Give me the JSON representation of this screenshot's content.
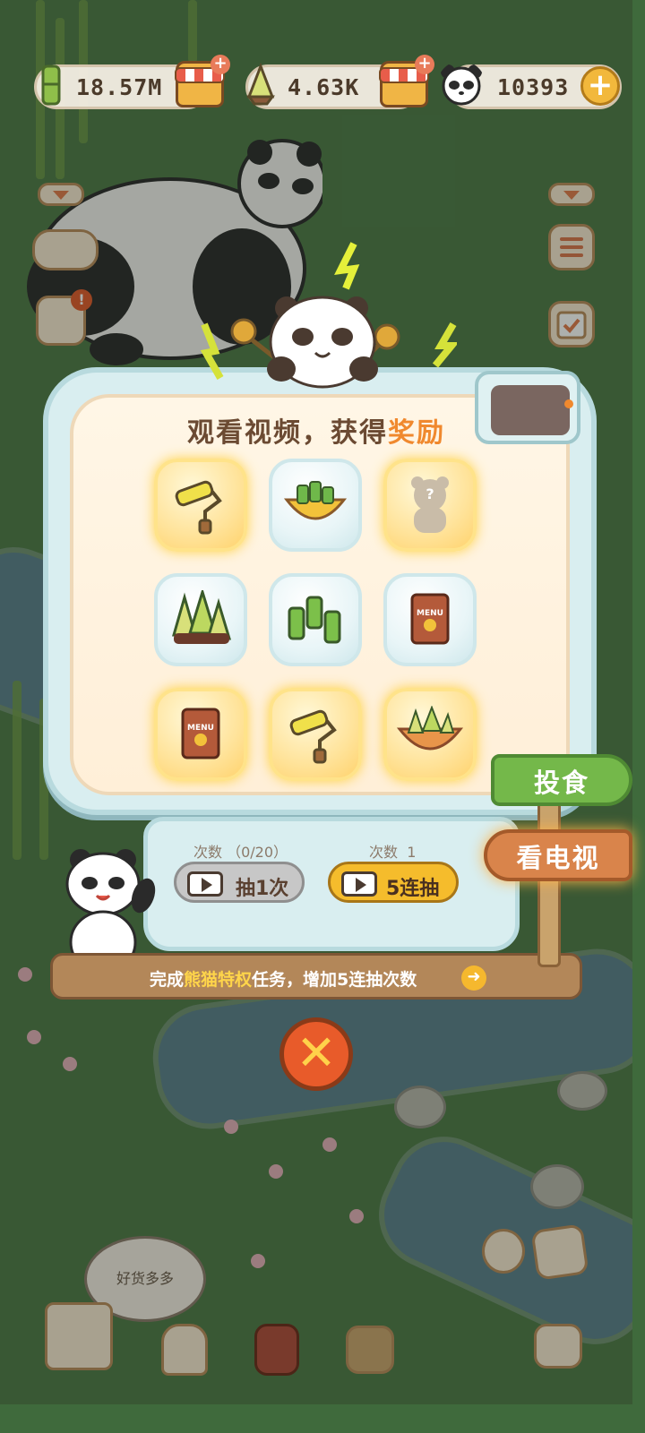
{
  "resources": {
    "bamboo_amount": "18.57M",
    "shoots_amount": "4.63K",
    "panda_coins": "10393"
  },
  "dialog": {
    "title_prefix": "观看视频，获得",
    "title_highlight": "奖励",
    "rewards": [
      {
        "item": "paint-roller",
        "style": "gold"
      },
      {
        "item": "bamboo-bowl",
        "style": "blue"
      },
      {
        "item": "mystery-bear",
        "style": "gold"
      },
      {
        "item": "bamboo-shoots",
        "style": "blue"
      },
      {
        "item": "bamboo-stalks",
        "style": "blue"
      },
      {
        "item": "menu-book",
        "style": "blue"
      },
      {
        "item": "menu-book",
        "style": "gold"
      },
      {
        "item": "paint-roller",
        "style": "gold"
      },
      {
        "item": "bamboo-shoot-bowl",
        "style": "gold"
      }
    ],
    "mystery_mark": "?",
    "menu_label": "MENU",
    "single_count_label": "次数",
    "single_count_value": "（0/20）",
    "five_count_label": "次数",
    "five_count_value": "1",
    "single_draw_label": "抽1次",
    "five_draw_label": "5连抽",
    "banner_prefix": "完成",
    "banner_highlight": "熊猫特权",
    "banner_suffix": "任务，增加5连抽次数",
    "banner_arrow": "➜",
    "close_symbol": "✕"
  },
  "signs": {
    "feed": "投食",
    "watch_tv": "看电视"
  },
  "world": {
    "speech_bubble": "好货多多",
    "add_symbol": "+"
  },
  "colors": {
    "accent_orange": "#f0892e",
    "gold_button": "#f5bc2c",
    "close_red": "#e85b2a",
    "sign_green": "#74b84a",
    "sign_orange": "#d9844b"
  }
}
